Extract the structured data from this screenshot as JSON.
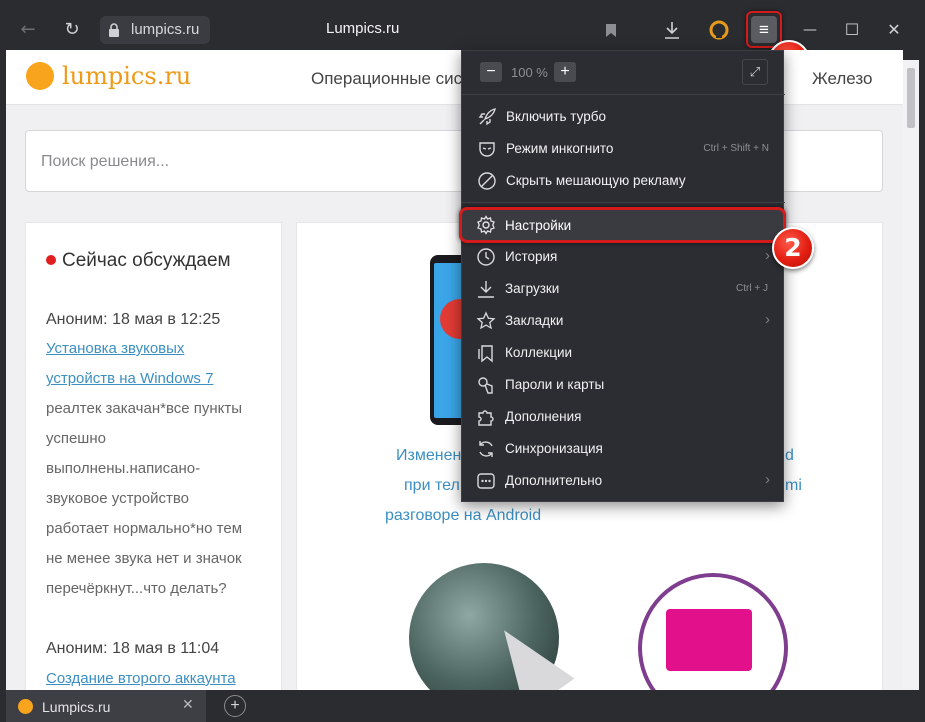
{
  "browser": {
    "address": "lumpics.ru",
    "title": "Lumpics.ru"
  },
  "site": {
    "logo_text": "lumpics.ru",
    "nav_left": "Операционные сис",
    "nav_right": "Железо",
    "search_placeholder": "Поиск решения..."
  },
  "sidebar": {
    "title": "Сейчас обсуждаем",
    "comments": [
      {
        "author": "Аноним: 18 мая в 12:25",
        "link_lines": [
          "Установка звуковых",
          "устройств на Windows 7"
        ],
        "text_lines": [
          "реалтек закачан*все пункты",
          "успешно",
          "выполнены.написано-",
          "звуковое устройство",
          "работает нормально*но тем",
          "не менее звука нет и значок",
          "перечёркнут...что делать?"
        ]
      },
      {
        "author": "Аноним: 18 мая в 11:04",
        "link_lines": [
          "Создание второго аккаунта"
        ],
        "text_lines": []
      }
    ]
  },
  "article": {
    "lines": [
      "Изменен",
      "при тел",
      "разговоре на Android",
      "d",
      "mi"
    ]
  },
  "menu": {
    "zoom_minus": "−",
    "zoom_value": "100 %",
    "zoom_plus": "+",
    "fullscreen": "⤢",
    "items": [
      {
        "label": "Включить турбо",
        "shortcut": "",
        "arrow": false
      },
      {
        "label": "Режим инкогнито",
        "shortcut": "Ctrl + Shift + N",
        "arrow": false
      },
      {
        "label": "Скрыть мешающую рекламу",
        "shortcut": "",
        "arrow": false
      },
      {
        "label": "Настройки",
        "shortcut": "",
        "arrow": false
      },
      {
        "label": "История",
        "shortcut": "",
        "arrow": true
      },
      {
        "label": "Загрузки",
        "shortcut": "Ctrl + J",
        "arrow": false
      },
      {
        "label": "Закладки",
        "shortcut": "",
        "arrow": true
      },
      {
        "label": "Коллекции",
        "shortcut": "",
        "arrow": false
      },
      {
        "label": "Пароли и карты",
        "shortcut": "",
        "arrow": false
      },
      {
        "label": "Дополнения",
        "shortcut": "",
        "arrow": false
      },
      {
        "label": "Синхронизация",
        "shortcut": "",
        "arrow": false
      },
      {
        "label": "Дополнительно",
        "shortcut": "",
        "arrow": true
      }
    ],
    "arrow_glyph": "›"
  },
  "badges": {
    "one": "1",
    "two": "2"
  },
  "tab": {
    "title": "Lumpics.ru",
    "close": "✕",
    "new": "+"
  },
  "icons": {
    "back": "back-arrow-icon",
    "reload": "reload-icon",
    "lock": "lock-icon",
    "bookmark": "bookmark-icon",
    "download": "download-icon",
    "protect": "protect-icon",
    "menu": "hamburger-icon",
    "minimize": "minimize-icon",
    "maximize": "maximize-icon",
    "close": "close-icon"
  },
  "glyphs": {
    "back": "←",
    "reload": "↻",
    "menu": "≡",
    "minimize": "—",
    "maximize": "☐",
    "close": "✕"
  },
  "colors": {
    "accent_red": "#d31b1b",
    "link": "#3c8fc2",
    "logo": "#f8a41c",
    "menu_bg": "#2c2d32"
  }
}
